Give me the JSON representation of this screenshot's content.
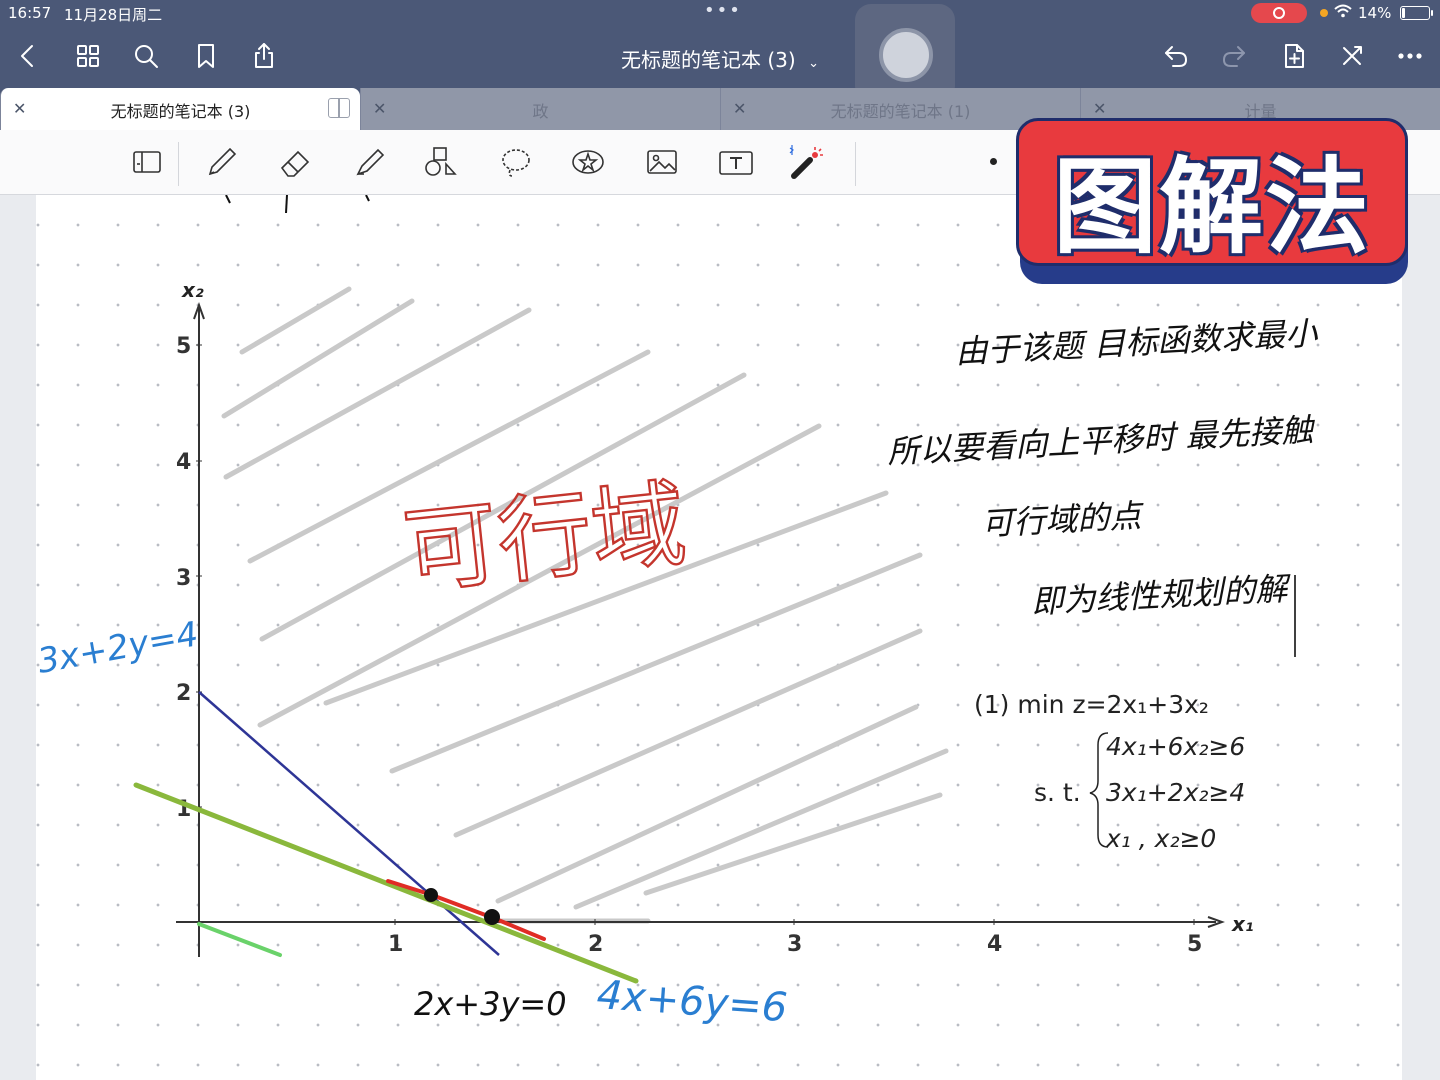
{
  "status_bar": {
    "time": "16:57",
    "date": "11月28日周二",
    "battery": "14%"
  },
  "nav": {
    "title": "无标题的笔记本 (3)"
  },
  "tabs": [
    {
      "label": "无标题的笔记本 (3)",
      "active": true
    },
    {
      "label": "政",
      "active": false
    },
    {
      "label": "无标题的笔记本 (1)",
      "active": false
    },
    {
      "label": "计量",
      "active": false
    }
  ],
  "overlay_title": "图解法",
  "graph": {
    "x_axis_label": "x₁",
    "y_axis_label": "x₂",
    "x_ticks": [
      "1",
      "2",
      "3",
      "4",
      "5"
    ],
    "y_ticks": [
      "1",
      "2",
      "3",
      "4",
      "5"
    ]
  },
  "handwriting": {
    "feasible_region": "可行域",
    "line1_label": "3x+2y=4",
    "line2_label": "4x+6y=6",
    "objective_label": "2x+3y=0",
    "note_line1": "由于该题 目标函数求最小",
    "note_line2": "所以要看向上平移时 最先接触",
    "note_line3": "可行域的点",
    "note_line4": "即为线性规划的解"
  },
  "problem": {
    "objective": "(1) min z=2x₁+3x₂",
    "st_label": "s. t.",
    "constraints": [
      "4x₁+6x₂≥6",
      "3x₁+2x₂≥4",
      "x₁ , x₂≥0"
    ]
  }
}
